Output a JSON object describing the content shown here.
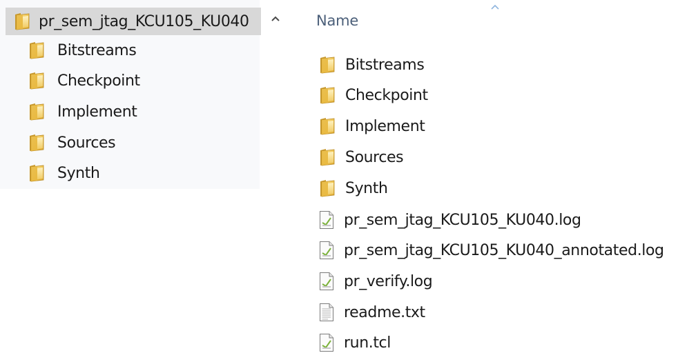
{
  "navigation": {
    "root": {
      "label": "pr_sem_jtag_KCU105_KU040"
    },
    "children": [
      {
        "label": "Bitstreams"
      },
      {
        "label": "Checkpoint"
      },
      {
        "label": "Implement"
      },
      {
        "label": "Sources"
      },
      {
        "label": "Synth"
      }
    ]
  },
  "content": {
    "column_header": "Name",
    "items": [
      {
        "label": "Bitstreams",
        "icon": "folder-icon"
      },
      {
        "label": "Checkpoint",
        "icon": "folder-icon"
      },
      {
        "label": "Implement",
        "icon": "folder-icon"
      },
      {
        "label": "Sources",
        "icon": "folder-icon"
      },
      {
        "label": "Synth",
        "icon": "folder-icon"
      },
      {
        "label": "pr_sem_jtag_KCU105_KU040.log",
        "icon": "log-file-icon"
      },
      {
        "label": "pr_sem_jtag_KCU105_KU040_annotated.log",
        "icon": "log-file-icon"
      },
      {
        "label": "pr_verify.log",
        "icon": "log-file-icon"
      },
      {
        "label": "readme.txt",
        "icon": "text-file-icon"
      },
      {
        "label": "run.tcl",
        "icon": "script-file-icon"
      }
    ]
  },
  "colors": {
    "selected_background": "#d8d8d8",
    "header_text": "#4c607a",
    "folder_yellow": "#f1c550"
  }
}
